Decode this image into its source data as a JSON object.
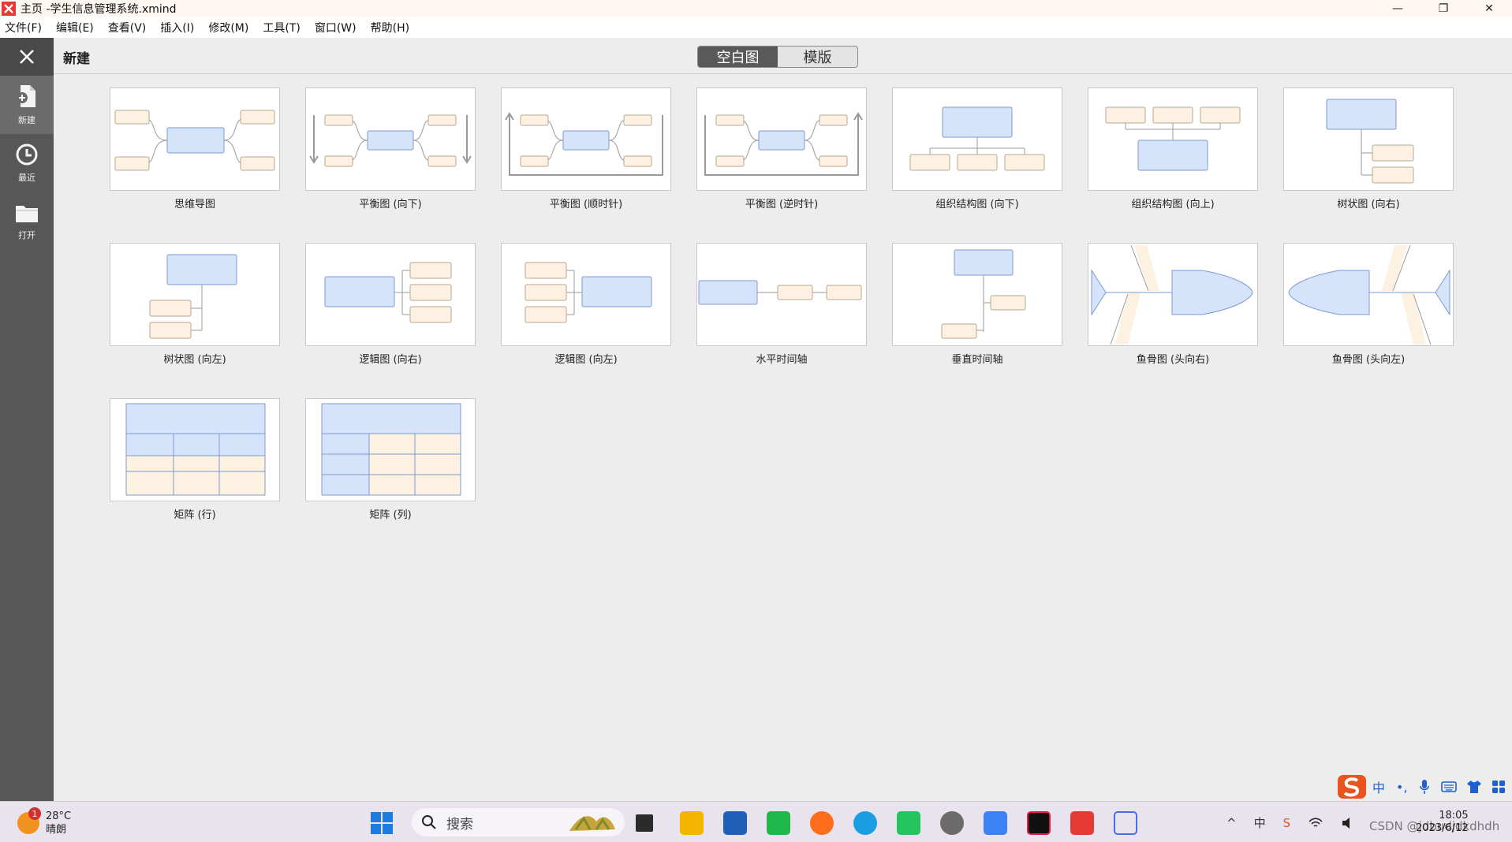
{
  "window": {
    "title": "主页 -学生信息管理系统.xmind",
    "minimize_label": "—",
    "restore_label": "❐",
    "close_label": "✕"
  },
  "menu": [
    "文件(F)",
    "编辑(E)",
    "查看(V)",
    "插入(I)",
    "修改(M)",
    "工具(T)",
    "窗口(W)",
    "帮助(H)"
  ],
  "sidebar": {
    "items": [
      {
        "label": "新建",
        "icon": "new-file-icon",
        "active": true
      },
      {
        "label": "最近",
        "icon": "clock-icon",
        "active": false
      },
      {
        "label": "打开",
        "icon": "folder-icon",
        "active": false
      }
    ]
  },
  "header": {
    "title": "新建",
    "segments": [
      "空白图",
      "模版"
    ],
    "active_segment": 0
  },
  "templates": [
    {
      "label": "思维导图",
      "kind": "mindmap"
    },
    {
      "label": "平衡图 (向下)",
      "kind": "balance-down"
    },
    {
      "label": "平衡图 (顺时针)",
      "kind": "balance-cw"
    },
    {
      "label": "平衡图 (逆时针)",
      "kind": "balance-ccw"
    },
    {
      "label": "组织结构图 (向下)",
      "kind": "org-down"
    },
    {
      "label": "组织结构图 (向上)",
      "kind": "org-up"
    },
    {
      "label": "树状图 (向右)",
      "kind": "tree-right"
    },
    {
      "label": "树状图 (向左)",
      "kind": "tree-left"
    },
    {
      "label": "逻辑图 (向右)",
      "kind": "logic-right"
    },
    {
      "label": "逻辑图 (向左)",
      "kind": "logic-left"
    },
    {
      "label": "水平时间轴",
      "kind": "timeline-h"
    },
    {
      "label": "垂直时间轴",
      "kind": "timeline-v"
    },
    {
      "label": "鱼骨图 (头向右)",
      "kind": "fish-right"
    },
    {
      "label": "鱼骨图 (头向左)",
      "kind": "fish-left"
    },
    {
      "label": "矩阵 (行)",
      "kind": "matrix-row"
    },
    {
      "label": "矩阵 (列)",
      "kind": "matrix-col"
    }
  ],
  "colors": {
    "main_topic_fill": "#d5e4fb",
    "main_topic_stroke": "#7d9ad0",
    "sub_topic_fill": "#fdf1e2",
    "sub_topic_stroke": "#b9a791",
    "line": "#9a9a9a"
  },
  "ime": {
    "items": [
      "S",
      "中",
      "•,",
      "mic-icon",
      "keyboard-icon",
      "shirt-icon",
      "grid-icon"
    ]
  },
  "taskbar": {
    "weather_temp": "28°C",
    "weather_desc": "晴朗",
    "weather_badge": "1",
    "search_placeholder": "搜索",
    "clock_time": "18:05",
    "clock_date": "2023/6/12",
    "watermark": "CSDN @jdbudjdkdhdh",
    "tray": [
      "^",
      "中",
      "S",
      "wifi-icon",
      "speaker-icon",
      "battery-icon"
    ]
  }
}
